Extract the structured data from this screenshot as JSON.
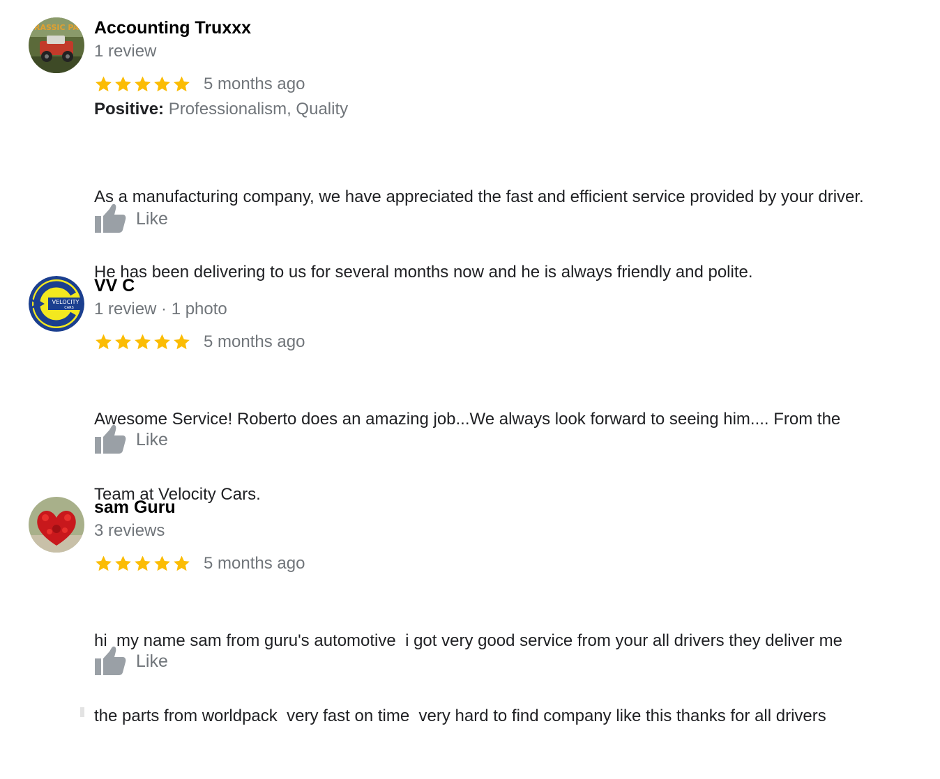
{
  "reviews": [
    {
      "reviewer_name": "Accounting Truxxx",
      "reviewer_meta": "1 review",
      "rating": 5,
      "time_ago": "5 months ago",
      "positive_label": "Positive:",
      "positive_values": "Professionalism, Quality",
      "text_lines": [
        "As a manufacturing company, we have appreciated the fast and efficient service provided by your driver.",
        "He has been delivering to us for several months now and he is always friendly and polite."
      ],
      "like_label": "Like",
      "avatar_text": "RASSIC PA"
    },
    {
      "reviewer_name": "VV C",
      "reviewer_meta": "1 review · 1 photo",
      "rating": 5,
      "time_ago": "5 months ago",
      "text_lines": [
        "Awesome Service! Roberto does an amazing job...We always look forward to seeing him.... From the",
        "Team at Velocity Cars."
      ],
      "like_label": "Like",
      "avatar_text": "VELOCITY",
      "avatar_subtext": "CARS"
    },
    {
      "reviewer_name": "sam Guru",
      "reviewer_meta": "3 reviews",
      "rating": 5,
      "time_ago": "5 months ago",
      "text_lines": [
        "hi  my name sam from guru's automotive  i got very good service from your all drivers they deliver me",
        "the parts from worldpack  very fast on time  very hard to find company like this thanks for all drivers"
      ],
      "like_label": "Like"
    }
  ],
  "colors": {
    "star": "#fbbc04",
    "secondary_text": "#70757a",
    "like_icon": "#9aa0a6",
    "primary_text": "#202124"
  },
  "icons": {
    "star": "star-icon",
    "like": "thumbs-up-icon"
  }
}
